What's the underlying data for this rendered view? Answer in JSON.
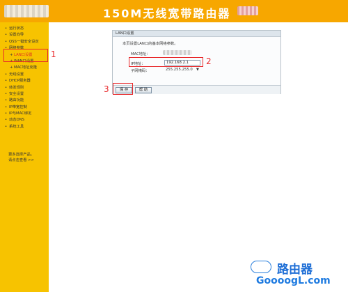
{
  "header": {
    "title": "150M无线宽带路由器"
  },
  "sidebar": {
    "items": [
      {
        "label": "运行状态",
        "sub": false,
        "active": false
      },
      {
        "label": "设置向导",
        "sub": false,
        "active": false
      },
      {
        "label": "QSS一键安全设定",
        "sub": false,
        "active": false
      },
      {
        "label": "网络参数",
        "sub": false,
        "active": false
      },
      {
        "label": "LAN口设置",
        "sub": true,
        "active": true
      },
      {
        "label": "WAN口设置",
        "sub": true,
        "active": false
      },
      {
        "label": "MAC地址克隆",
        "sub": true,
        "active": false
      },
      {
        "label": "无线设置",
        "sub": false,
        "active": false
      },
      {
        "label": "DHCP服务器",
        "sub": false,
        "active": false
      },
      {
        "label": "转发规则",
        "sub": false,
        "active": false
      },
      {
        "label": "安全设置",
        "sub": false,
        "active": false
      },
      {
        "label": "路由功能",
        "sub": false,
        "active": false
      },
      {
        "label": "IP带宽控制",
        "sub": false,
        "active": false
      },
      {
        "label": "IP与MAC绑定",
        "sub": false,
        "active": false
      },
      {
        "label": "动态DNS",
        "sub": false,
        "active": false
      },
      {
        "label": "系统工具",
        "sub": false,
        "active": false
      }
    ],
    "more_line1": "更多选择产品，",
    "more_line2": "请点击查看 >>"
  },
  "panel": {
    "title": "LAN口设置",
    "description": "本页设置LAN口的基本网络参数。",
    "mac_label": "MAC地址：",
    "ip_label": "IP地址：",
    "ip_value": "192.168.2.1",
    "mask_label": "子网掩码：",
    "mask_value": "255.255.255.0",
    "save_label": "保 存",
    "help_label": "帮 助"
  },
  "annotations": {
    "n1": "1",
    "n2": "2",
    "n3": "3"
  },
  "watermark": {
    "cn": "路由器",
    "en": "GoooogL.com"
  },
  "colors": {
    "header_bg": "#f7a700",
    "sidebar_bg": "#f7c300",
    "annotation": "#e8282a"
  }
}
